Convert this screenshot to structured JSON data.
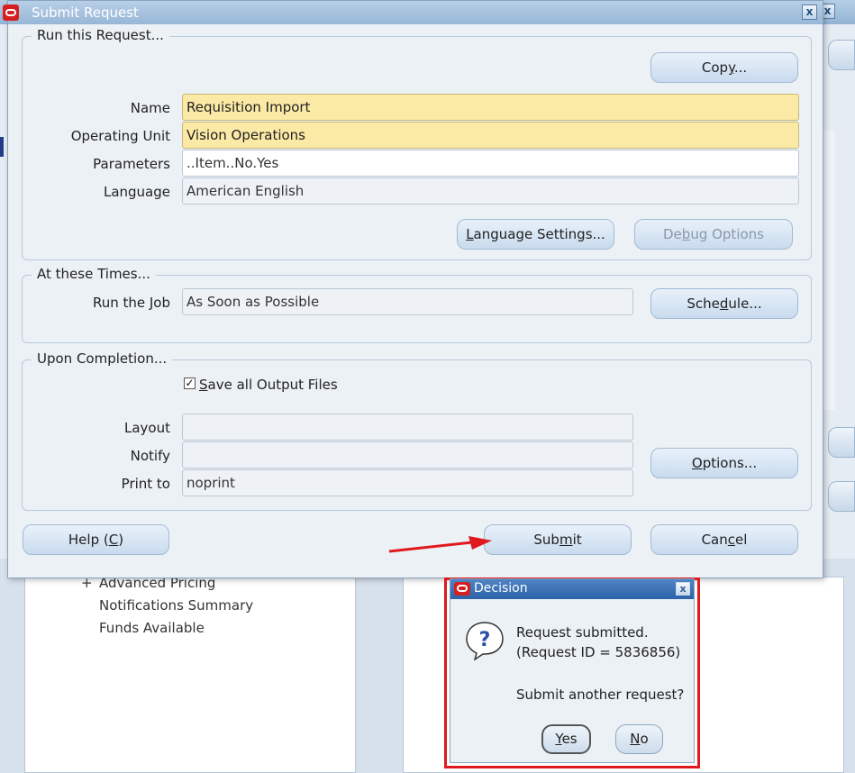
{
  "submit_request": {
    "title": "Submit Request",
    "close_glyph": "x",
    "run_group": {
      "label": "Run this Request...",
      "copy_button": {
        "pre": "Cop",
        "mnemonic": "y",
        "post": "..."
      },
      "fields": {
        "name": {
          "label": "Name",
          "value": "Requisition Import"
        },
        "operating_unit": {
          "label": "Operating Unit",
          "value": "Vision Operations"
        },
        "parameters": {
          "label": "Parameters",
          "value": "..Item..No.Yes"
        },
        "language": {
          "label": "Language",
          "value": "American English"
        }
      },
      "language_settings_button": {
        "pre": "",
        "mnemonic": "L",
        "post": "anguage Settings..."
      },
      "debug_options_button": {
        "pre": "De",
        "mnemonic": "b",
        "post": "ug Options"
      }
    },
    "times_group": {
      "label": "At these Times...",
      "run_job": {
        "label": "Run the Job",
        "value": "As Soon as Possible"
      },
      "schedule_button": {
        "pre": "Sche",
        "mnemonic": "d",
        "post": "ule..."
      }
    },
    "completion_group": {
      "label": "Upon Completion...",
      "save_output": {
        "checked": true,
        "check_glyph": "✓",
        "mnemonic": "S",
        "post": "ave all Output Files"
      },
      "layout": {
        "label": "Layout",
        "value": ""
      },
      "notify": {
        "label": "Notify",
        "value": ""
      },
      "print_to": {
        "label": "Print to",
        "value": "noprint"
      },
      "options_button": {
        "pre": "",
        "mnemonic": "O",
        "post": "ptions..."
      }
    },
    "footer": {
      "help_button": {
        "pre": "Help (",
        "mnemonic": "C",
        "post": ")"
      },
      "submit_button": {
        "pre": "Sub",
        "mnemonic": "m",
        "post": "it"
      },
      "cancel_button": {
        "pre": "Can",
        "mnemonic": "c",
        "post": "el"
      }
    }
  },
  "background_navigator": {
    "items": [
      {
        "prefix": "+",
        "label": "Advanced Pricing"
      },
      {
        "prefix": "",
        "label": "Notifications Summary"
      },
      {
        "prefix": "",
        "label": "Funds Available"
      }
    ]
  },
  "decision": {
    "title": "Decision",
    "close_glyph": "x",
    "message_line1": "Request submitted.",
    "message_line2": "(Request ID = 5836856)",
    "question": "Submit another request?",
    "yes_button": {
      "mnemonic": "Y",
      "post": "es"
    },
    "no_button": {
      "mnemonic": "N",
      "post": "o"
    }
  },
  "colors": {
    "required_field": "#fbe9a6",
    "highlight_border": "#e0191f",
    "arrow": "#e0191f",
    "titlebar": "#97b6d6"
  },
  "icons": {
    "app_icon": "oracle-logo-icon",
    "decision_icon": "question-bubble-icon"
  }
}
